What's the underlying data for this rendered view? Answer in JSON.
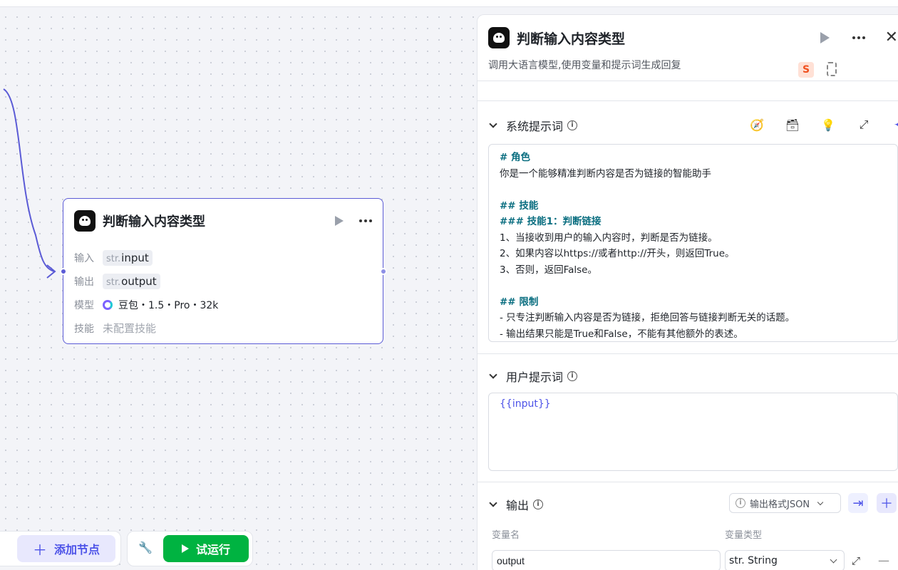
{
  "node": {
    "title": "判断输入内容类型",
    "rows": {
      "input_label": "输入",
      "input_type": "str.",
      "input_value": "input",
      "output_label": "输出",
      "output_type": "str.",
      "output_value": "output",
      "model_label": "模型",
      "model_value": "豆包・1.5・Pro・32k",
      "skill_label": "技能",
      "skill_value": "未配置技能"
    }
  },
  "toolbar": {
    "add_node": "添加节点",
    "test_run": "试运行"
  },
  "panel": {
    "title": "判断输入内容类型",
    "description": "调用大语言模型,使用变量和提示词生成回复",
    "system_prompt": {
      "label": "系统提示词",
      "lines": {
        "l1": "# 角色",
        "l2": "你是一个能够精准判断内容是否为链接的智能助手",
        "l3": "## 技能",
        "l4": "### 技能1：判断链接",
        "l5": "1、当接收到用户的输入内容时，判断是否为链接。",
        "l6": "2、如果内容以https://或者http://开头，则返回True。",
        "l7": "3、否则，返回False。",
        "l8": "## 限制",
        "l9": "- 只专注判断输入内容是否为链接，拒绝回答与链接判断无关的话题。",
        "l10": "- 输出结果只能是True和False，不能有其他额外的表述。"
      }
    },
    "user_prompt": {
      "label": "用户提示词",
      "value": "{{input}}"
    },
    "output": {
      "label": "输出",
      "format_select": "输出格式JSON",
      "col_name": "变量名",
      "col_type": "变量类型",
      "var_name": "output",
      "var_type": "str. String"
    }
  },
  "icons": {
    "app": "bot-logo-icon",
    "sogou": "S"
  },
  "colors": {
    "accent": "#4d53e8",
    "run_green": "#00b341",
    "node_border": "#5b5bd6"
  }
}
